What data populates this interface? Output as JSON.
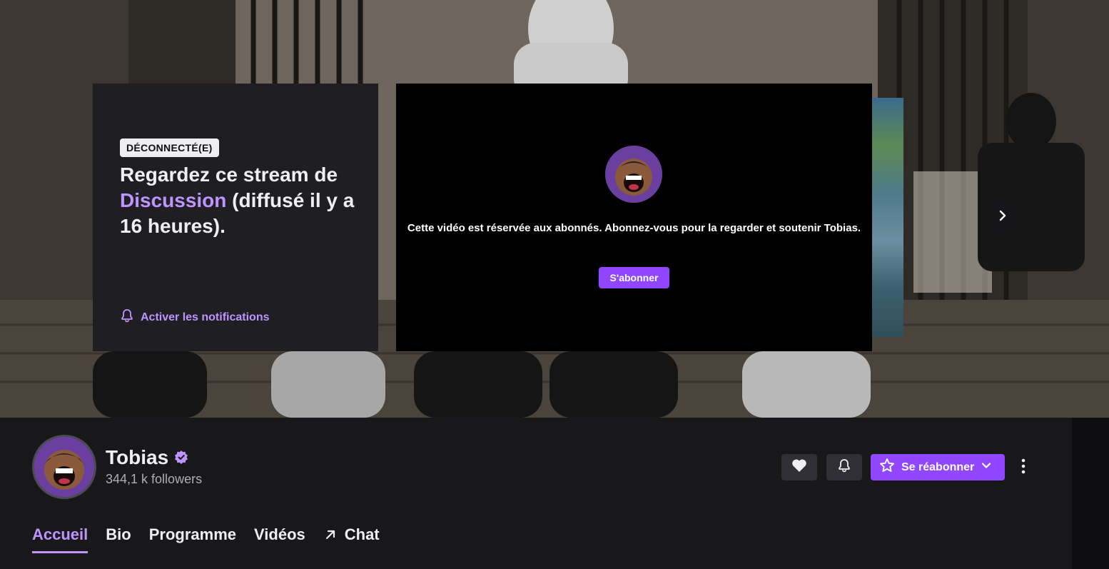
{
  "offline": {
    "badge": "DÉCONNECTÉ(E)",
    "text_prefix": "Regardez ce stream de ",
    "category": "Discussion",
    "text_suffix": " (diffusé il y a 16 heures).",
    "notification_label": "Activer les notifications"
  },
  "player": {
    "message": "Cette vidéo est réservée aux abonnés. Abonnez-vous pour la regarder et soutenir Tobias.",
    "subscribe_label": "S'abonner"
  },
  "channel": {
    "name": "Tobias",
    "followers": "344,1 k followers",
    "resub_label": "Se réabonner"
  },
  "tabs": [
    {
      "label": "Accueil",
      "active": true
    },
    {
      "label": "Bio"
    },
    {
      "label": "Programme"
    },
    {
      "label": "Vidéos"
    },
    {
      "label": "Chat",
      "icon": "external-arrow-icon"
    }
  ],
  "colors": {
    "accent": "#9147ff",
    "accent_text": "#bf94ff",
    "background": "#0e0e10",
    "panel": "#18181b",
    "card": "#1f1f23"
  },
  "icons": {
    "verified": "verified-badge-icon",
    "heart": "heart-icon",
    "bell": "bell-icon",
    "star": "star-icon",
    "chevron_down": "chevron-down-icon",
    "chevron_right": "chevron-right-icon",
    "more": "more-vertical-icon"
  }
}
